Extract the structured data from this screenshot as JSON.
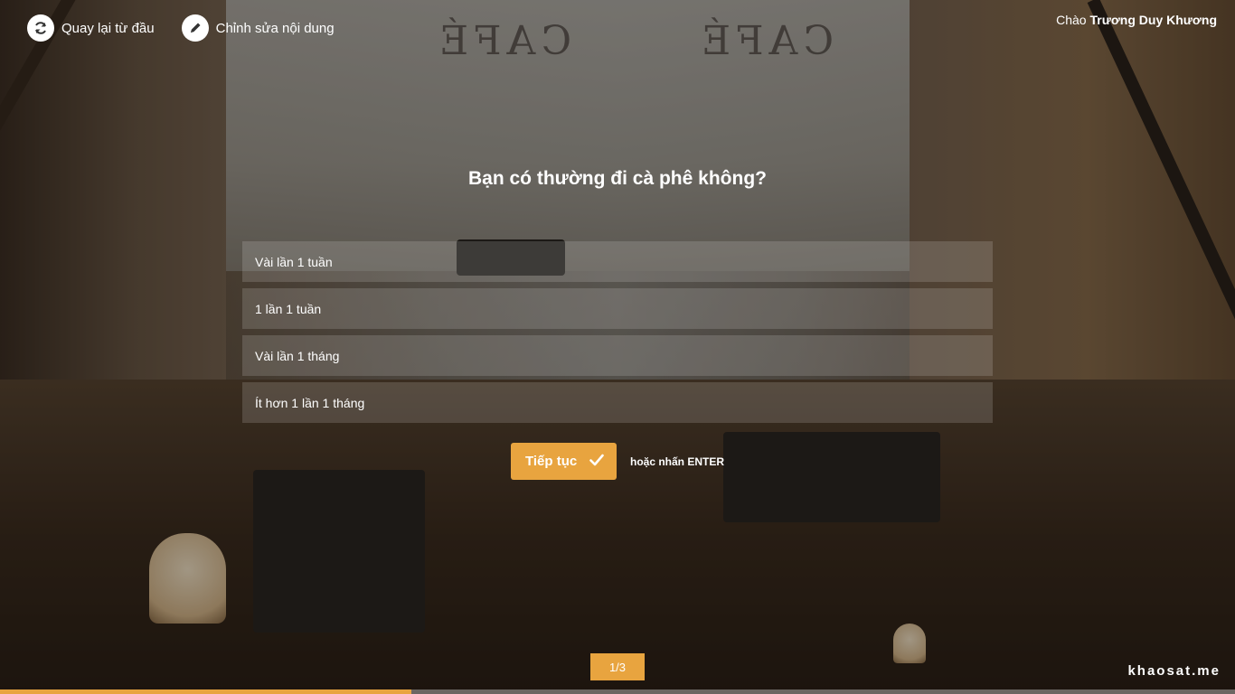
{
  "topbar": {
    "restart_label": "Quay lại từ đầu",
    "restart_icon": "refresh-icon",
    "edit_label": "Chỉnh sửa nội dung",
    "edit_icon": "pencil-icon"
  },
  "greeting": {
    "prefix": "Chào",
    "user": "Trương Duy Khương"
  },
  "question": "Bạn có thường đi cà phê không?",
  "options": [
    {
      "label": "Vài lần 1 tuần"
    },
    {
      "label": "1 lần 1 tuần"
    },
    {
      "label": "Vài lần 1 tháng"
    },
    {
      "label": "Ít hơn 1 lần 1 tháng"
    }
  ],
  "actions": {
    "continue_label": "Tiếp tục",
    "continue_icon": "check-icon",
    "hint": "hoặc nhấn ENTER"
  },
  "pager": "1/3",
  "brand": "khaosat.me",
  "progress": {
    "fraction": 0.333
  },
  "colors": {
    "accent": "#e8a43f",
    "option_bg": "rgba(255,255,255,0.15)"
  }
}
